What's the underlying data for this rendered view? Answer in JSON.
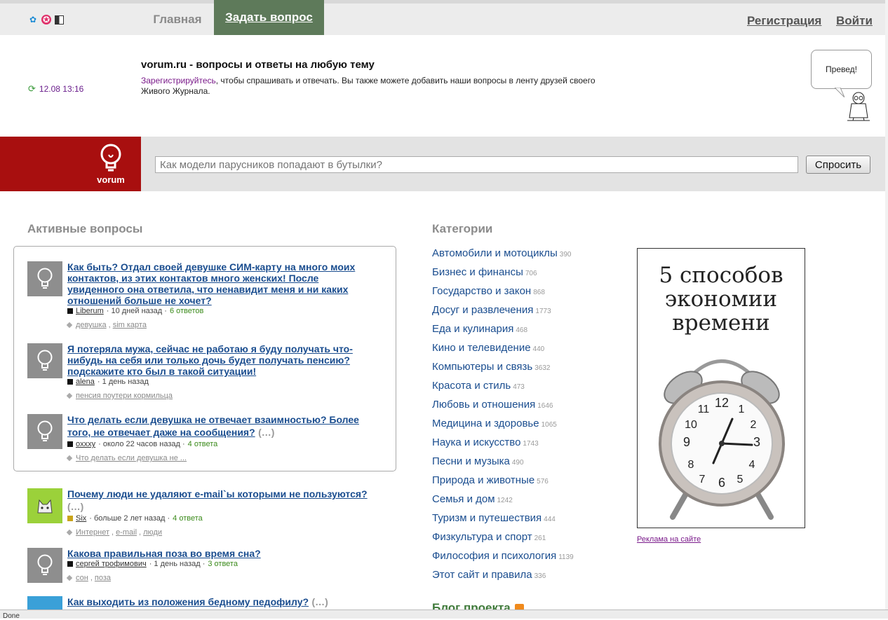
{
  "nav": {
    "home": "Главная",
    "ask": "Задать вопрос",
    "register": "Регистрация",
    "login": "Войти"
  },
  "header": {
    "updated": "12.08 13:16",
    "title": "vorum.ru - вопросы и ответы на любую тему",
    "register_link": "Зарегистрируйтесь",
    "desc_rest": ", чтобы спрашивать и отвечать. Вы также можете добавить наши вопросы в ленту друзей своего Живого Журнала.",
    "bubble": "Превед!"
  },
  "search": {
    "brand": "vorum",
    "placeholder": "Как модели парусников попадают в бутылки?",
    "button": "Спросить"
  },
  "active": {
    "heading": "Активные вопросы",
    "questions": [
      {
        "title": "Как быть? Отдал своей девушке СИМ-карту на много моих контактов, из этих контактов много женских! После увиденного она ответила, что ненавидит меня и ни каких отношений больше не хочет?",
        "more": "",
        "author": "Liberum",
        "time": "· 10 дней назад ·",
        "answers": "6 ответов",
        "tags": [
          "девушка",
          "sim карта"
        ]
      },
      {
        "title": "Я потеряла мужа, сейчас не работаю я буду получать что-нибудь на себя или только дочь будет получать пенсию?подскажите кто был в такой ситуации!",
        "more": "",
        "author": "alena",
        "time": "· 1 день назад",
        "answers": "",
        "tags": [
          "пенсия поутери кормильца"
        ]
      },
      {
        "title": "Что делать если девушка не отвечает взаимностью? Более того, не отвечает даже на сообщения?",
        "more": "(…)",
        "author": "oxxxy",
        "time": "· около 22 часов назад ·",
        "answers": "4 ответа",
        "tags": [
          "Что делать если девушка не ..."
        ]
      },
      {
        "title": "Почему люди не удаляют e-mail`ы которыми не пользуются?",
        "more": "(…)",
        "author": "Six",
        "time": "· больше 2 лет назад ·",
        "answers": "4 ответа",
        "tags": [
          "Интернет",
          "e-mail",
          "люди"
        ]
      },
      {
        "title": "Какова правильная поза во время сна?",
        "more": "",
        "author": "сергей трофимович",
        "time": "· 1 день назад ·",
        "answers": "3 ответа",
        "tags": [
          "сон",
          "поза"
        ]
      },
      {
        "title": "Как выходить из положения бедному педофилу?",
        "more": "(…)",
        "author": "",
        "time": "",
        "answers": "",
        "tags": []
      }
    ]
  },
  "categories": {
    "heading": "Категории",
    "items": [
      {
        "name": "Автомобили и мотоциклы",
        "count": "390"
      },
      {
        "name": "Бизнес и финансы",
        "count": "706"
      },
      {
        "name": "Государство и закон",
        "count": "868"
      },
      {
        "name": "Досуг и развлечения",
        "count": "1773"
      },
      {
        "name": "Еда и кулинария",
        "count": "468"
      },
      {
        "name": "Кино и телевидение",
        "count": "440"
      },
      {
        "name": "Компьютеры и связь",
        "count": "3632"
      },
      {
        "name": "Красота и стиль",
        "count": "473"
      },
      {
        "name": "Любовь и отношения",
        "count": "1646"
      },
      {
        "name": "Медицина и здоровье",
        "count": "1065"
      },
      {
        "name": "Наука и искусство",
        "count": "1743"
      },
      {
        "name": "Песни и музыка",
        "count": "490"
      },
      {
        "name": "Природа и животные",
        "count": "576"
      },
      {
        "name": "Семья и дом",
        "count": "1242"
      },
      {
        "name": "Туризм и путешествия",
        "count": "444"
      },
      {
        "name": "Физкультура и спорт",
        "count": "261"
      },
      {
        "name": "Философия и психология",
        "count": "1139"
      },
      {
        "name": "Этот сайт и правила",
        "count": "336"
      }
    ],
    "blog": "Блог проекта"
  },
  "ad": {
    "line1": "5 способов",
    "line2": "экономии",
    "line3": "времени",
    "link": "Реклама на сайте"
  },
  "status": "Done"
}
